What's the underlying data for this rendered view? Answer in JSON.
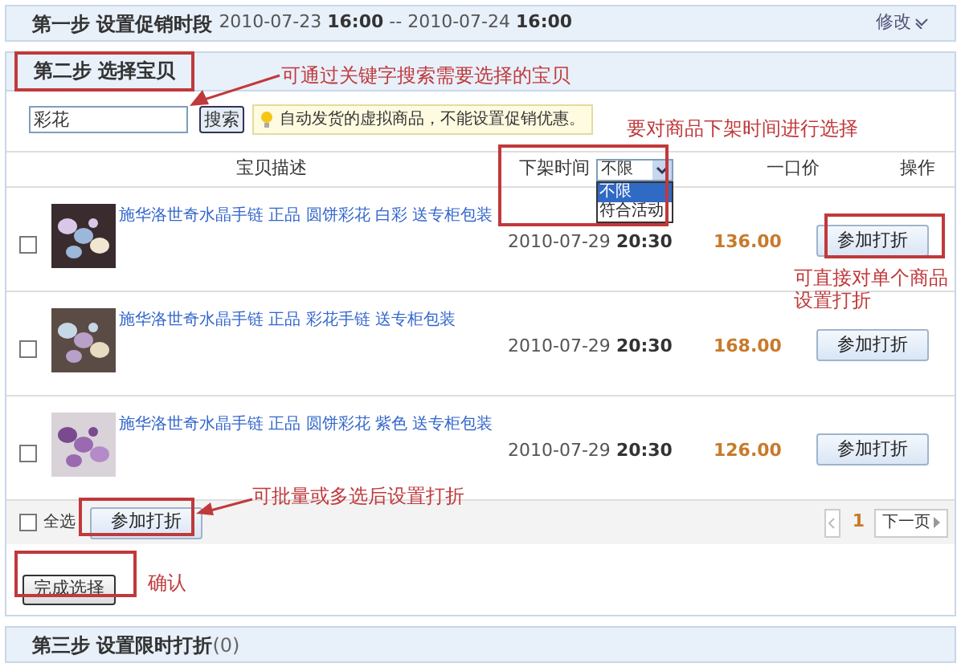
{
  "step1": {
    "title": "第一步 设置促销时段",
    "start_date": "2010-07-23",
    "start_time": "16:00",
    "separator": "--",
    "end_date": "2010-07-24",
    "end_time": "16:00",
    "edit_link": "修改"
  },
  "step2": {
    "title": "第二步 选择宝贝",
    "search": {
      "value": "彩花",
      "button": "搜索"
    },
    "notice": "自动发货的虚拟商品，不能设置促销优惠。",
    "columns": [
      "宝贝描述",
      "一口价",
      "操作"
    ],
    "filter": {
      "label": "下架时间",
      "value": "不限",
      "options": [
        {
          "label": "不限",
          "selected": true
        },
        {
          "label": "符合活动",
          "selected": false
        }
      ]
    },
    "rows": [
      {
        "title": "施华洛世奇水晶手链 正品 圆饼彩花 白彩 送专柜包装",
        "date": "2010-07-29",
        "time": "20:30",
        "price": "136.00",
        "button": "参加打折",
        "checked": false
      },
      {
        "title": "施华洛世奇水晶手链 正品 彩花手链 送专柜包装",
        "date": "2010-07-29",
        "time": "20:30",
        "price": "168.00",
        "button": "参加打折",
        "checked": false
      },
      {
        "title": "施华洛世奇水晶手链 正品 圆饼彩花 紫色 送专柜包装",
        "date": "2010-07-29",
        "time": "20:30",
        "price": "126.00",
        "button": "参加打折",
        "checked": false
      }
    ],
    "footer": {
      "select_all": "全选",
      "select_all_checked": false,
      "button": "参加打折",
      "page": "1",
      "next": "下一页"
    },
    "finish_button": "完成选择"
  },
  "step3": {
    "title": "第三步 设置限时打折",
    "count": "(0)"
  },
  "annotations": [
    {
      "text": "可通过关键字搜索需要选择的宝贝"
    },
    {
      "text": "要对商品下架时间进行选择"
    },
    {
      "text": "可直接对单个商品设置打折"
    },
    {
      "text": "可批量或多选后设置打折"
    },
    {
      "text": "确认"
    }
  ]
}
